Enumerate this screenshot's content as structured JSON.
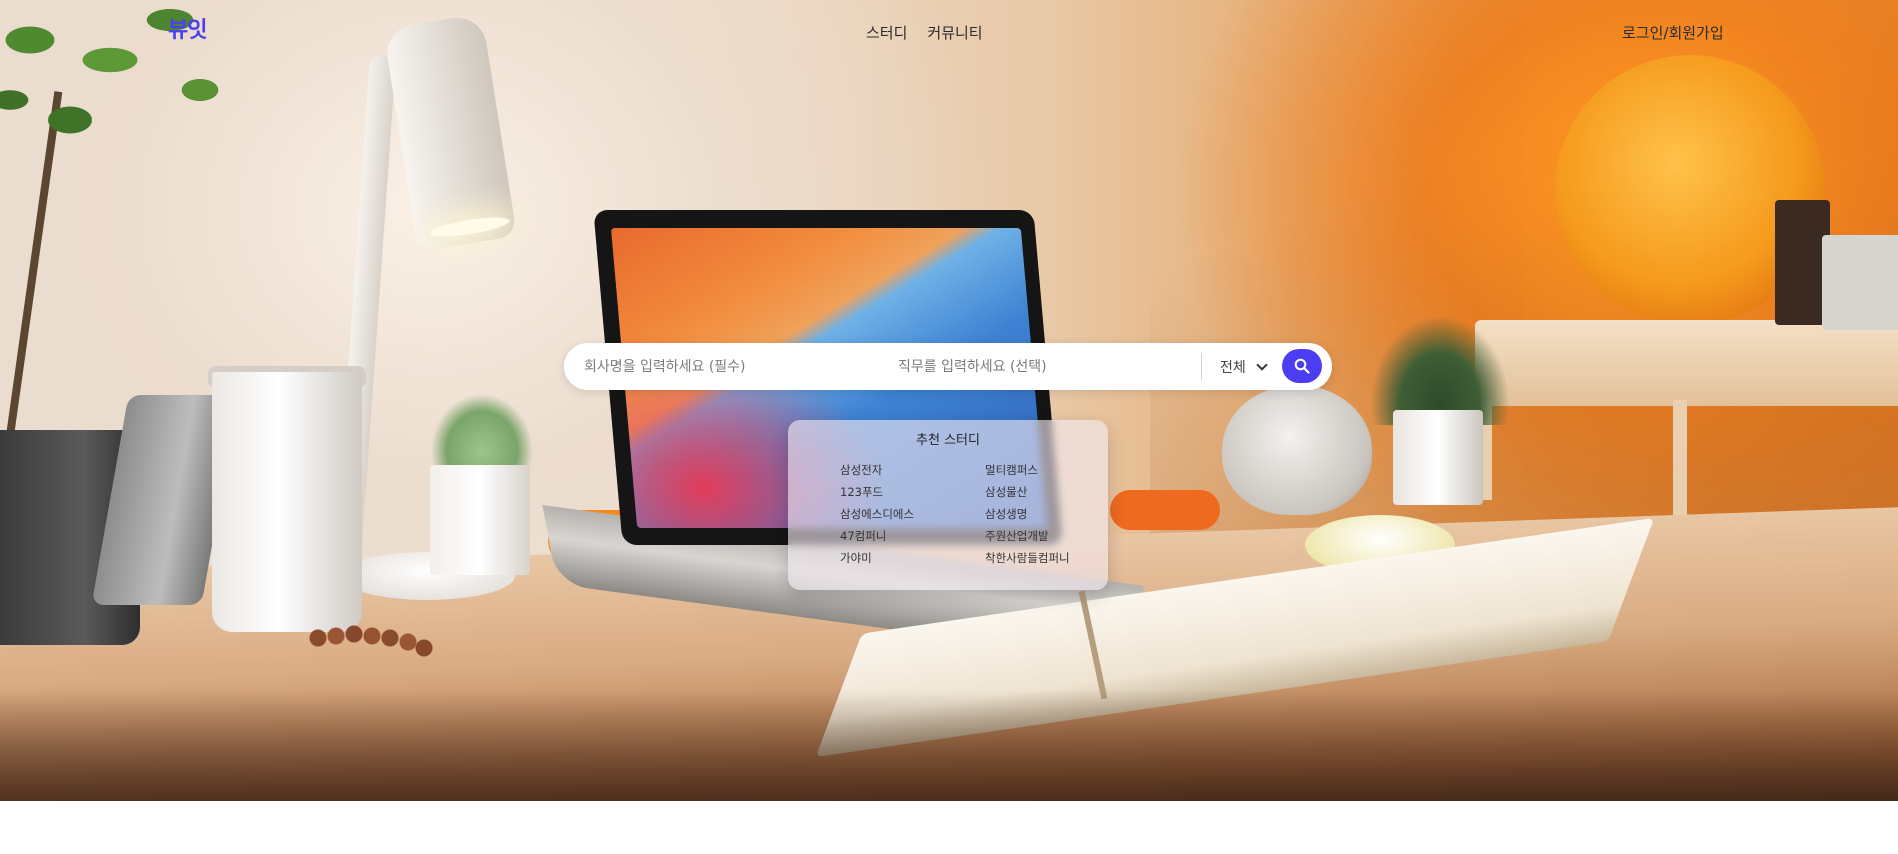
{
  "header": {
    "logo": "뷰잇",
    "nav": [
      "스터디",
      "커뮤니티"
    ],
    "login": "로그인/회원가입"
  },
  "search": {
    "company_placeholder": "회사명을 입력하세요 (필수)",
    "job_placeholder": "직무를 입력하세요 (선택)",
    "category_selected": "전체",
    "button_icon": "search-icon"
  },
  "recommended": {
    "title": "추천 스터디",
    "left": [
      "삼성전자",
      "123푸드",
      "삼성에스디에스",
      "47컴퍼니",
      "가야미"
    ],
    "right": [
      "멀티캠퍼스",
      "삼성물산",
      "삼성생명",
      "주원산업개발",
      "착한사람들컴퍼니"
    ]
  },
  "colors": {
    "accent": "#4a3df2",
    "logo": "#4b3ff5"
  }
}
